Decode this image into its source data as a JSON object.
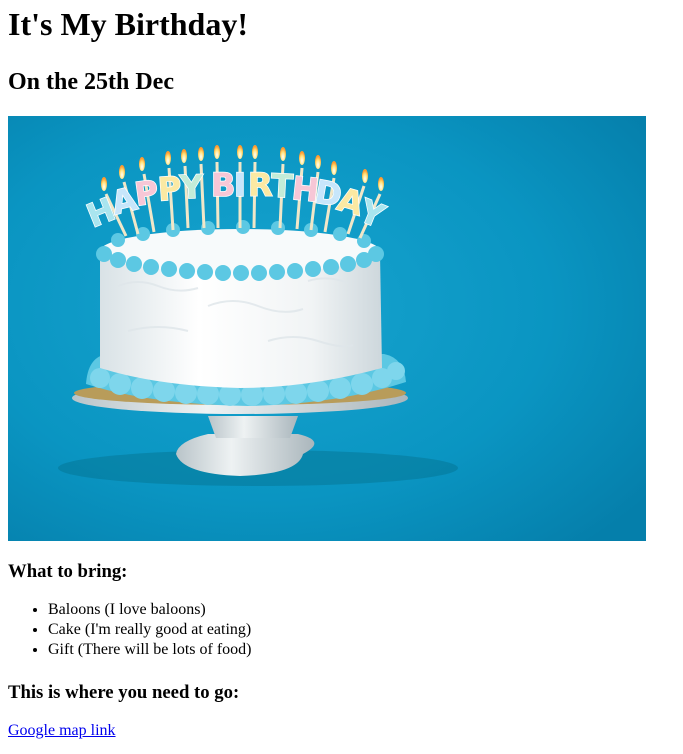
{
  "page": {
    "title": "It's My Birthday!",
    "subtitle": "On the 25th Dec"
  },
  "hero_image": {
    "banner_text": "HAPPY BIRTHDAY",
    "background_color": "#0a95c2",
    "frosting_color": "#5cc8e3",
    "cake_color": "#f4f6f7"
  },
  "bring": {
    "heading": "What to bring:",
    "items": [
      "Baloons (I love baloons)",
      "Cake (I'm really good at eating)",
      "Gift (There will be lots of food)"
    ]
  },
  "location": {
    "heading": "This is where you need to go:",
    "link_text": "Google map link",
    "link_color": "#0000ee"
  }
}
